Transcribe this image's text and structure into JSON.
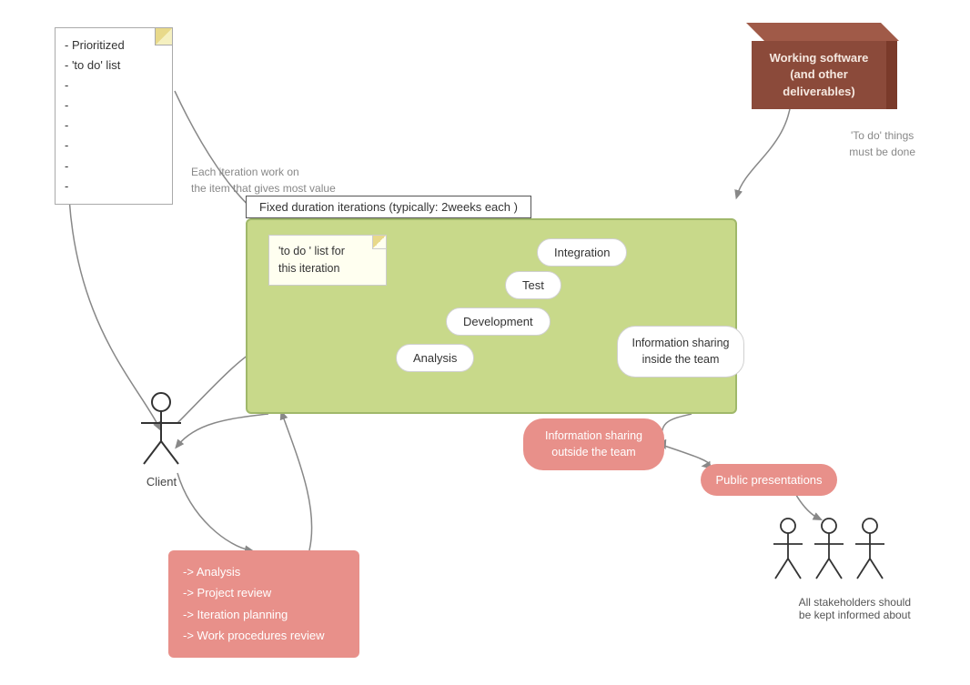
{
  "prioritized_box": {
    "lines": [
      "- Prioritized",
      "- 'to do' list",
      "-",
      "-",
      "-",
      "-",
      "-",
      "-"
    ]
  },
  "each_iter_text": {
    "line1": "Each iteration work on",
    "line2": "the item that gives most value"
  },
  "working_software": {
    "label": "Working software\n(and other deliverables)"
  },
  "todo_must_text": {
    "line1": "'To do' things",
    "line2": "must be done"
  },
  "fixed_duration": {
    "label": "Fixed duration iterations (typically: 2weeks each )"
  },
  "todo_iter_note": {
    "label": "'to do ' list for\nthis iteration"
  },
  "pills": {
    "integration": "Integration",
    "test": "Test",
    "development": "Development",
    "analysis": "Analysis"
  },
  "info_share_inside": {
    "label": "Information sharing\ninside the team"
  },
  "info_share_outside": {
    "label": "Information sharing\noutside the team"
  },
  "public_presentations": {
    "label": "Public presentations"
  },
  "client": {
    "label": "Client"
  },
  "stakeholders": {
    "label": "All stakeholders should\nbe kept informed about"
  },
  "actions_box": {
    "lines": [
      "-> Analysis",
      "-> Project review",
      "-> Iteration planning",
      "-> Work procedures review"
    ]
  }
}
